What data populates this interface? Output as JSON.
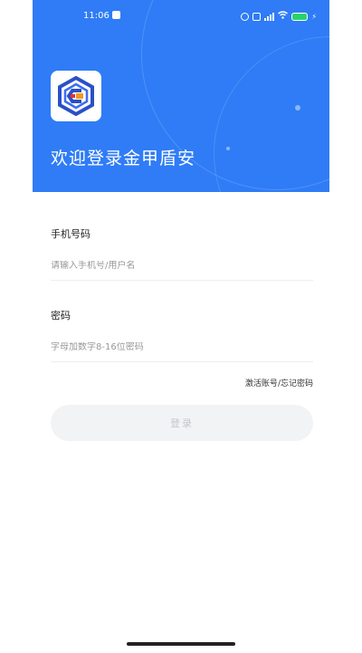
{
  "status_bar": {
    "time": "11:06",
    "icons": [
      "alarm-icon",
      "vibrate-icon",
      "signal-icon",
      "wifi-icon",
      "battery-icon"
    ],
    "battery_color": "#29d36b"
  },
  "header": {
    "background_color": "#2f7cf6",
    "logo_icon": "app-logo-icon",
    "welcome_text": "欢迎登录金甲盾安"
  },
  "form": {
    "phone": {
      "label": "手机号码",
      "placeholder": "请输入手机号/用户名",
      "value": ""
    },
    "password": {
      "label": "密码",
      "placeholder": "字母加数字8-16位密码",
      "value": ""
    },
    "links": {
      "activate": "激活账号",
      "separator": "/",
      "forgot": "忘记密码"
    },
    "login_label": "登录",
    "login_button_color": "#f2f3f5"
  }
}
